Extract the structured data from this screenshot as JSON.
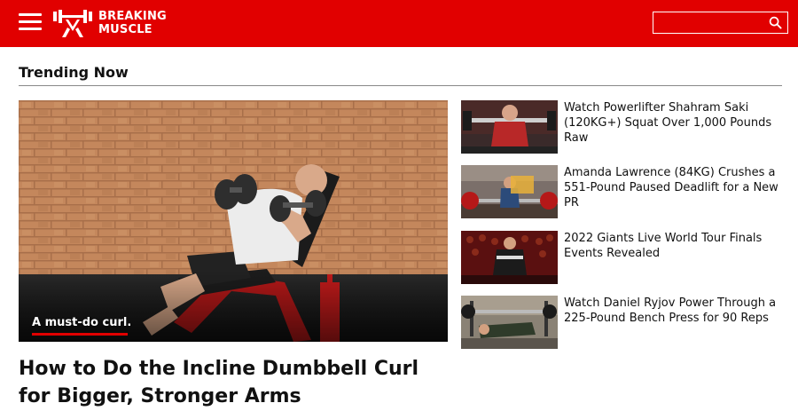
{
  "header": {
    "brand_line1": "BREAKING",
    "brand_line2": "MUSCLE",
    "brand_color": "#e10000",
    "menu_icon": "hamburger-menu-icon",
    "search": {
      "placeholder": "",
      "value": "",
      "icon": "search-icon"
    }
  },
  "section": {
    "title": "Trending Now"
  },
  "hero": {
    "caption": "A must-do curl.",
    "title": "How to Do the Incline Dumbbell Curl for Bigger, Stronger Arms"
  },
  "side_articles": [
    {
      "title": "Watch Powerlifter Shahram Saki (120KG+) Squat Over 1,000 Pounds Raw"
    },
    {
      "title": "Amanda Lawrence (84KG) Crushes a 551-Pound Paused Deadlift for a New PR"
    },
    {
      "title": "2022 Giants Live World Tour Finals Events Revealed"
    },
    {
      "title": "Watch Daniel Ryjov Power Through a 225-Pound Bench Press for 90 Reps"
    }
  ]
}
